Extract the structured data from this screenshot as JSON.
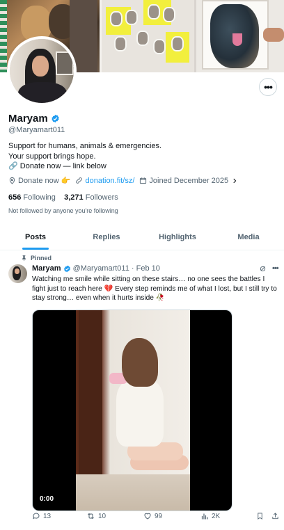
{
  "profile": {
    "name": "Maryam",
    "handle": "@Maryamart011",
    "bio": [
      "Support for humans, animals & emergencies.",
      "Your support brings hope.",
      "🔗 Donate now — link below"
    ],
    "location": "Donate now 👉",
    "link": "donation.fit/sz/",
    "joined": "Joined December 2025",
    "following_count": "656",
    "following_label": "Following",
    "followers_count": "3,271",
    "followers_label": "Followers",
    "not_followed": "Not followed by anyone you're following"
  },
  "tabs": [
    "Posts",
    "Replies",
    "Highlights",
    "Media"
  ],
  "post": {
    "pinned_label": "Pinned",
    "author": "Maryam",
    "handle_date": "@Maryamart011 · Feb 10",
    "text": "Watching me smile while sitting on these stairs… no one sees the battles I fight just to reach here 💔 Every step reminds me of what I lost, but I still try to stay strong… even when it hurts inside 🥀",
    "video_time": "0:00",
    "replies": "13",
    "reposts": "10",
    "likes": "99",
    "views": "2K"
  },
  "colors": {
    "accent": "#1d9bf0",
    "muted": "#536471",
    "text": "#0f1419"
  },
  "icons": [
    "more-icon",
    "verified-icon",
    "location-icon",
    "link-icon",
    "calendar-icon",
    "pin-icon",
    "grok-icon",
    "reply-icon",
    "repost-icon",
    "like-icon",
    "views-icon",
    "bookmark-icon",
    "share-icon"
  ]
}
